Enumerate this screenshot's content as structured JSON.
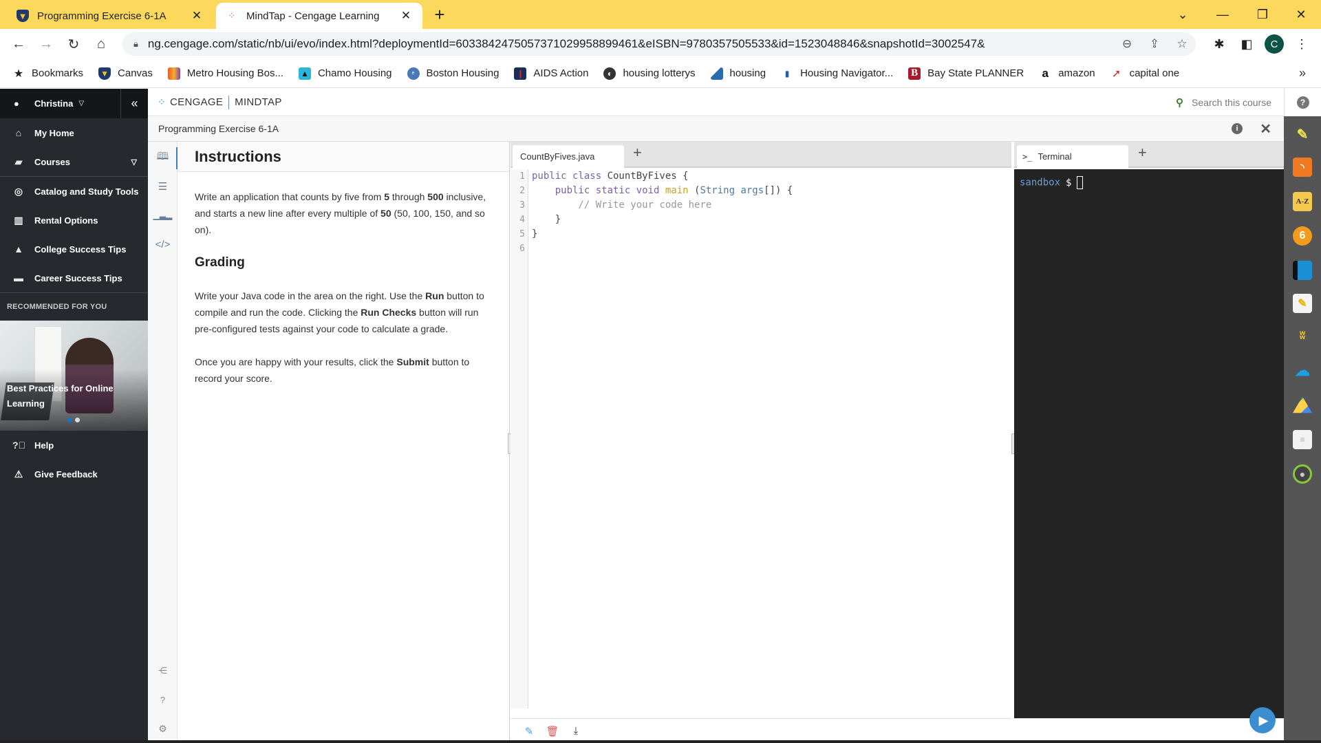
{
  "browser": {
    "tabs": [
      {
        "title": "Programming Exercise 6-1A",
        "active": false,
        "icon": "shield-favicon"
      },
      {
        "title": "MindTap - Cengage Learning",
        "active": true,
        "icon": "cengage-favicon"
      }
    ],
    "new_tab_label": "+",
    "url": "ng.cengage.com/static/nb/ui/evo/index.html?deploymentId=6033842475057371029958899461&eISBN=9780357505533&id=1523048846&snapshotId=3002547&",
    "profile_initial": "C",
    "bookmarks": [
      {
        "label": "Bookmarks",
        "icon": "star-icon"
      },
      {
        "label": "Canvas",
        "icon": "shield-icon"
      },
      {
        "label": "Metro Housing Bos...",
        "icon": "people-icon"
      },
      {
        "label": "Chamo Housing",
        "icon": "house-icon"
      },
      {
        "label": "Boston Housing",
        "icon": "elite-icon"
      },
      {
        "label": "AIDS Action",
        "icon": "ribbon-icon"
      },
      {
        "label": "housing lotterys",
        "icon": "globe-icon"
      },
      {
        "label": "housing",
        "icon": "chart-icon"
      },
      {
        "label": "Housing Navigator...",
        "icon": "flag-icon"
      },
      {
        "label": "Bay State PLANNER",
        "icon": "b-icon"
      },
      {
        "label": "amazon",
        "icon": "amazon-icon"
      },
      {
        "label": "capital one",
        "icon": "swoosh-icon"
      }
    ],
    "bookmarks_overflow": "»"
  },
  "sidebar": {
    "user_name": "Christina",
    "items": [
      {
        "label": "My Home",
        "icon": "home-icon"
      },
      {
        "label": "Courses",
        "icon": "book-icon",
        "expandable": true
      },
      {
        "label": "Catalog and Study Tools",
        "icon": "compass-icon"
      },
      {
        "label": "Rental Options",
        "icon": "open-book-icon"
      },
      {
        "label": "College Success Tips",
        "icon": "graduation-cap-icon"
      },
      {
        "label": "Career Success Tips",
        "icon": "briefcase-icon"
      }
    ],
    "recommended_heading": "RECOMMENDED FOR YOU",
    "promo_title": "Best Practices for Online Learning",
    "promo_slides": 2,
    "promo_active_slide": 1,
    "footer_items": [
      {
        "label": "Help",
        "icon": "help-icon"
      },
      {
        "label": "Give Feedback",
        "icon": "feedback-icon"
      }
    ]
  },
  "header": {
    "brand": "CENGAGE",
    "product": "MINDTAP",
    "search_placeholder": "Search this course"
  },
  "exercise": {
    "title": "Programming Exercise 6-1A"
  },
  "instructions": {
    "heading": "Instructions",
    "para1_parts": [
      "Write an application that counts by five from ",
      "5",
      " through ",
      "500",
      " inclusive, and starts a new line after every multiple of ",
      "50",
      " (50, 100, 150, and so on)."
    ],
    "grading_heading": "Grading",
    "para2_parts": [
      "Write your Java code in the area on the right. Use the ",
      "Run",
      " button to compile and run the code. Clicking the ",
      "Run Checks",
      " button will run pre-configured tests against your code to calculate a grade."
    ],
    "para3_parts": [
      "Once you are happy with your results, click the ",
      "Submit",
      " button to record your score."
    ]
  },
  "editor": {
    "file_tab": "CountByFives.java",
    "add_tab": "+",
    "line_numbers": [
      "1",
      "2",
      "3",
      "4",
      "5",
      "6"
    ],
    "code": {
      "l1_kw": "public class ",
      "l1_rest": "CountByFives {",
      "l2_indent": "    ",
      "l2_kw": "public static void ",
      "l2_fn": "main",
      "l2_paren": " (",
      "l2_type": "String args",
      "l2_rest": "[]) {",
      "l3": "        // Write your code here",
      "l4": "    }",
      "l5": "}",
      "l6": ""
    }
  },
  "terminal": {
    "tab_label": "Terminal",
    "tab_prompt_glyph": ">_",
    "add_tab": "+",
    "host": "sandbox",
    "prompt": "$"
  }
}
